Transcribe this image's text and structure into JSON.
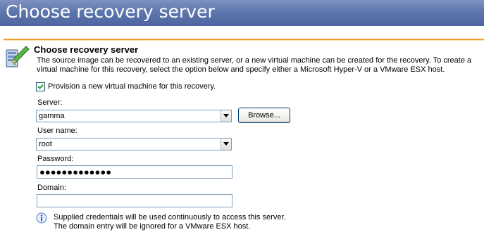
{
  "banner": {
    "title": "Choose recovery server"
  },
  "section": {
    "title": "Choose recovery server",
    "description": "The source image can be recovered to an existing server, or a new virtual machine can be created for the recovery.  To create a virtual machine for this recovery, select the option below and specify either a Microsoft Hyper-V or a VMware ESX host."
  },
  "provision": {
    "label": "Provision a new virtual machine for this recovery.",
    "checked": true
  },
  "server": {
    "label": "Server:",
    "value": "gamma",
    "browse_label": "Browse..."
  },
  "username": {
    "label": "User name:",
    "value": "root"
  },
  "password": {
    "label": "Password:",
    "masked_value": "●●●●●●●●●●●●●"
  },
  "domain": {
    "label": "Domain:",
    "value": ""
  },
  "info": {
    "line1": "Supplied credentials will be used continuously to access this server.",
    "line2": "The domain entry will be ignored for a VMware ESX host."
  },
  "icons": {
    "header": "server-recovery-icon",
    "info": "info-icon",
    "dropdown": "chevron-down-icon"
  },
  "colors": {
    "banner": "#5d76ad",
    "rule": "#f0a030",
    "input_border": "#7f9db9"
  }
}
